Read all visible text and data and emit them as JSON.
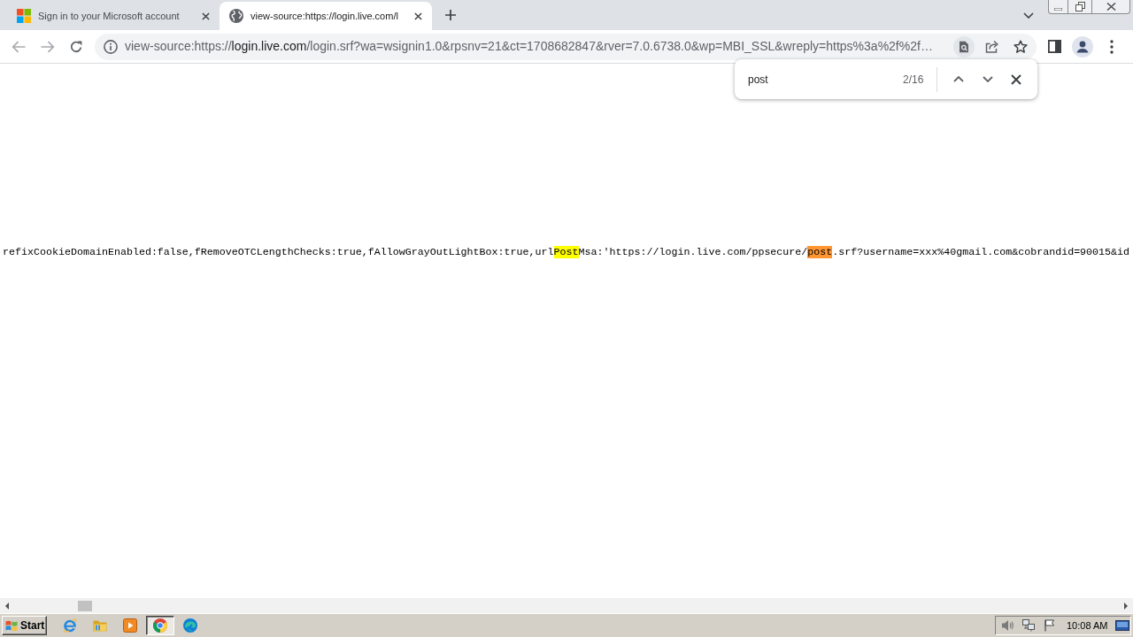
{
  "tabs": [
    {
      "kind": "logo",
      "title": "Sign in to your Microsoft account",
      "selected": false
    },
    {
      "kind": "globe",
      "title": "view-source:https://login.live.com/l",
      "selected": true
    }
  ],
  "address_bar": {
    "url_prefix": "view-source:https://",
    "url_host": "login.live.com",
    "url_rest": "/login.srf?wa=wsignin1.0&rpsnv=21&ct=1708682847&rver=7.0.6738.0&wp=MBI_SSL&wreply=https%3a%2f%2f…",
    "find_active": true
  },
  "find_bar": {
    "query": "post",
    "count": "2/16"
  },
  "source": {
    "segments": [
      {
        "kind": "plain",
        "text": "refixCookieDomainEnabled:false,fRemoveOTCLengthChecks:true,fAllowGrayOutLightBox:true,url"
      },
      {
        "kind": "match",
        "text": "Post"
      },
      {
        "kind": "plain",
        "text": "Msa:'https://login.live.com/ppsecure/"
      },
      {
        "kind": "current",
        "text": "post"
      },
      {
        "kind": "plain",
        "text": ".srf?username=xxx%40gmail.com&cobrandid=90015&id"
      }
    ]
  },
  "taskbar": {
    "start_label": "Start",
    "apps": [
      {
        "kind": "letter",
        "selected": false
      },
      {
        "kind": "folder",
        "selected": false
      },
      {
        "kind": "player",
        "selected": false
      },
      {
        "kind": "ring",
        "selected": true
      },
      {
        "kind": "swirl",
        "selected": false
      }
    ],
    "clock": "10:08 AM"
  }
}
